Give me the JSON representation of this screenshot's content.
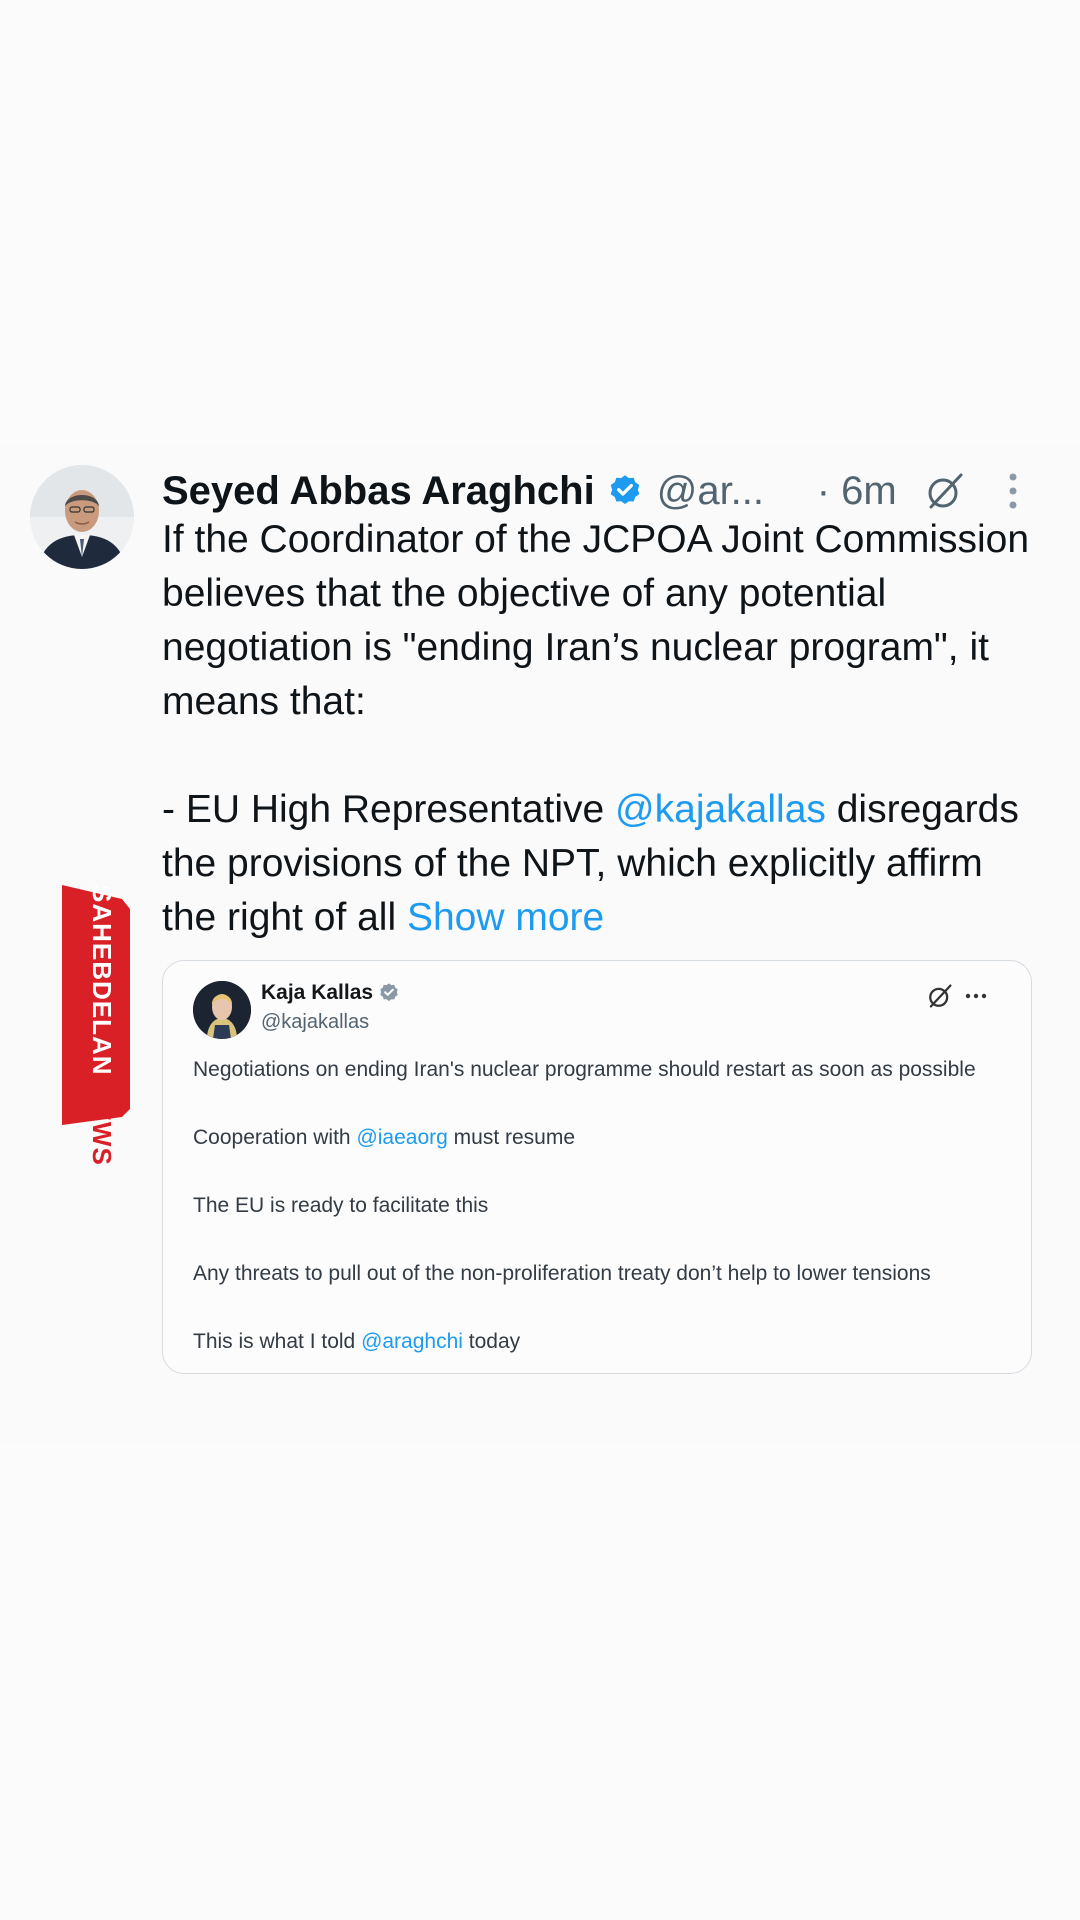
{
  "tweet": {
    "author_name": "Seyed Abbas Araghchi",
    "handle": "@ar...",
    "time": "· 6m",
    "avatar_icon": "user-avatar",
    "verified_icon": "verified-badge-icon",
    "grok_icon": "grok-icon",
    "more_icon": "more-vertical-icon",
    "paragraph_1": "If the Coordinator of the JCPOA Joint Commission believes that the objective of any potential negotiation is \"ending Iran’s nuclear program\", it means that:",
    "paragraph_2_prefix": "- EU High Representative ",
    "paragraph_2_mention": "@kajakallas",
    "paragraph_2_rest": " disregards the provisions of the NPT, which explicitly affirm the right of all ",
    "show_more": "Show more"
  },
  "quote": {
    "author_name": "Kaja Kallas",
    "handle": "@kajakallas",
    "line_1": "Negotiations on ending Iran's nuclear programme should restart as soon as possible",
    "line_2_prefix": "Cooperation with ",
    "line_2_mention": "@iaeaorg",
    "line_2_rest": " must resume",
    "line_3": "The EU is ready to facilitate this",
    "line_4": "Any threats to pull out of the non-proliferation treaty don’t help to lower tensions",
    "line_5_prefix": "This is what I told ",
    "line_5_mention": "@araghchi",
    "line_5_rest": " today"
  },
  "watermark": {
    "part_1": "SAHEBDELAN",
    "part_2": ".NEWS"
  },
  "colors": {
    "link": "#1d9bf0",
    "verified": "#1d9bf0",
    "watermark_red": "#d92027",
    "background": "#fafafa"
  }
}
